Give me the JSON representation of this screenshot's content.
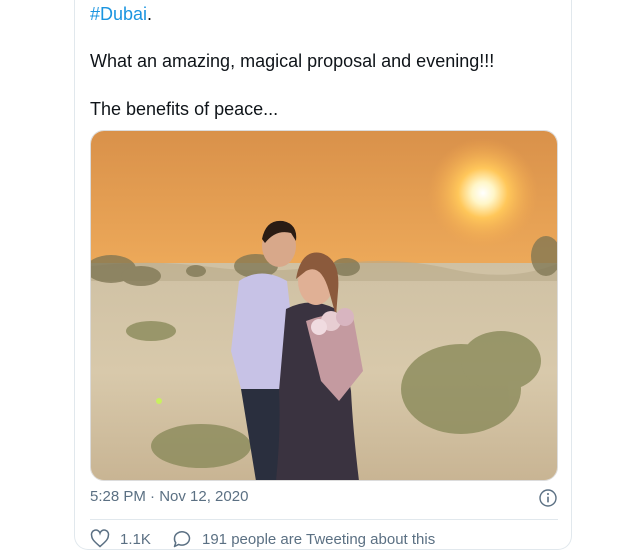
{
  "tweet": {
    "hashtag": "#Dubai",
    "hashtag_suffix": ".",
    "line_proposal": "What an amazing, magical proposal and evening!!!",
    "line_peace": "The benefits of peace...",
    "timestamp": "5:28 PM · Nov 12, 2020",
    "likes": "1.1K",
    "conversation": "191 people are Tweeting about this"
  },
  "icons": {
    "info": "info-circle-icon",
    "like": "heart-icon",
    "reply": "speech-bubble-icon"
  },
  "colors": {
    "link": "#1b95e0",
    "secondary_text": "#5b7083",
    "border": "#e1e8ed"
  }
}
